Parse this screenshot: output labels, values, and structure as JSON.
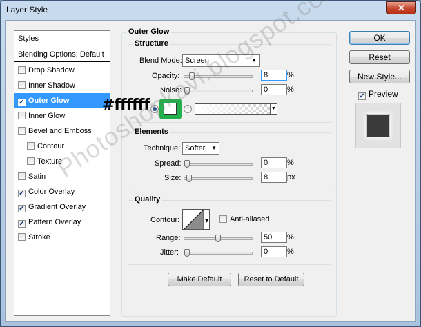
{
  "window": {
    "title": "Layer Style",
    "close_label": "✕"
  },
  "styles_list": {
    "header": "Styles",
    "blending": "Blending Options: Default",
    "items": [
      {
        "label": "Drop Shadow",
        "checked": false,
        "indent": false,
        "selected": false
      },
      {
        "label": "Inner Shadow",
        "checked": false,
        "indent": false,
        "selected": false
      },
      {
        "label": "Outer Glow",
        "checked": true,
        "indent": false,
        "selected": true
      },
      {
        "label": "Inner Glow",
        "checked": false,
        "indent": false,
        "selected": false
      },
      {
        "label": "Bevel and Emboss",
        "checked": false,
        "indent": false,
        "selected": false
      },
      {
        "label": "Contour",
        "checked": false,
        "indent": true,
        "selected": false
      },
      {
        "label": "Texture",
        "checked": false,
        "indent": true,
        "selected": false
      },
      {
        "label": "Satin",
        "checked": false,
        "indent": false,
        "selected": false
      },
      {
        "label": "Color Overlay",
        "checked": true,
        "indent": false,
        "selected": false
      },
      {
        "label": "Gradient Overlay",
        "checked": true,
        "indent": false,
        "selected": false
      },
      {
        "label": "Pattern Overlay",
        "checked": true,
        "indent": false,
        "selected": false
      },
      {
        "label": "Stroke",
        "checked": false,
        "indent": false,
        "selected": false
      }
    ]
  },
  "outer_glow": {
    "title": "Outer Glow",
    "structure": {
      "title": "Structure",
      "blend_mode_label": "Blend Mode:",
      "blend_mode_value": "Screen",
      "opacity_label": "Opacity:",
      "opacity_value": "8",
      "opacity_fraction": 0.08,
      "noise_label": "Noise:",
      "noise_value": "0",
      "noise_fraction": 0,
      "percent": "%",
      "color_hex_label": "#ffffff",
      "color": "#ffffff"
    },
    "elements": {
      "title": "Elements",
      "technique_label": "Technique:",
      "technique_value": "Softer",
      "spread_label": "Spread:",
      "spread_value": "0",
      "spread_fraction": 0,
      "size_label": "Size:",
      "size_value": "8",
      "size_fraction": 0.032,
      "percent": "%",
      "px": "px"
    },
    "quality": {
      "title": "Quality",
      "contour_label": "Contour:",
      "anti_aliased_label": "Anti-aliased",
      "anti_aliased_checked": false,
      "range_label": "Range:",
      "range_value": "50",
      "range_fraction": 0.5,
      "jitter_label": "Jitter:",
      "jitter_value": "0",
      "jitter_fraction": 0,
      "percent": "%"
    },
    "make_default_label": "Make Default",
    "reset_default_label": "Reset to Default"
  },
  "buttons": {
    "ok": "OK",
    "reset": "Reset",
    "new_style": "New Style..."
  },
  "preview": {
    "label": "Preview",
    "checked": true
  },
  "watermark": "Photoshopkavi.blogspot.com",
  "colors": {
    "selection": "#3399ff",
    "highlight_swatch": "#22b14c"
  }
}
